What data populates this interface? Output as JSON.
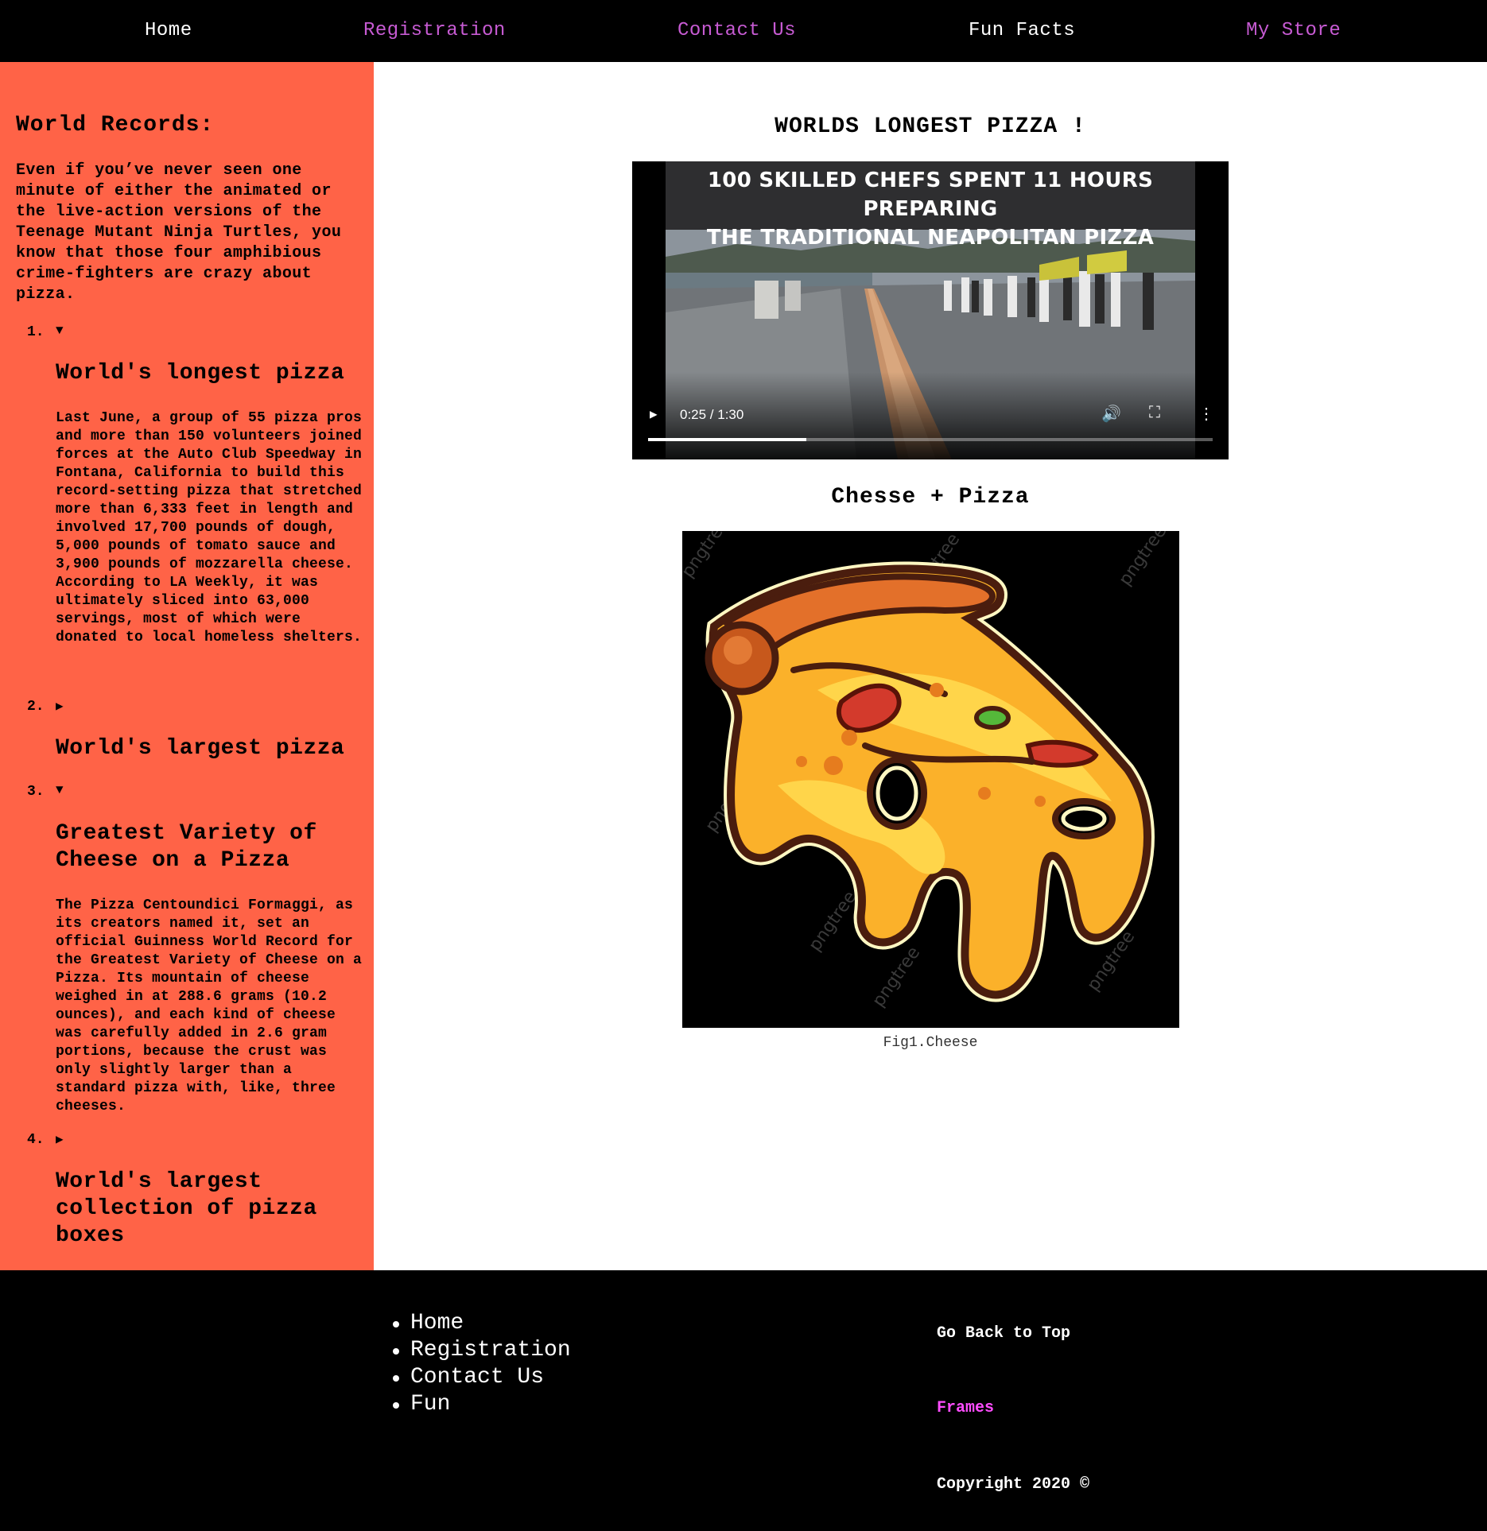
{
  "nav": {
    "items": [
      {
        "label": "Home",
        "color": "#ffffff"
      },
      {
        "label": "Registration",
        "color": "#c75bd3"
      },
      {
        "label": "Contact Us",
        "color": "#c75bd3"
      },
      {
        "label": "Fun Facts",
        "color": "#ffffff"
      },
      {
        "label": "My Store",
        "color": "#c75bd3"
      }
    ]
  },
  "sidebar": {
    "heading": "World Records:",
    "intro": "Even if you’ve never seen one minute of either the animated or the live-action versions of the Teenage Mutant Ninja Turtles, you know that those four amphibious crime-fighters are crazy about pizza.",
    "records": [
      {
        "num": "1.",
        "marker": "▼",
        "title": "World's longest pizza",
        "text": "Last June, a group of 55 pizza pros and more than 150 volunteers joined forces at the Auto Club Speedway in Fontana, California to build this record-setting pizza that stretched more than 6,333 feet in length and involved 17,700 pounds of dough, 5,000 pounds of tomato sauce and 3,900 pounds of mozzarella cheese. According to LA Weekly, it was ultimately sliced into 63,000 servings, most of which were donated to local homeless shelters."
      },
      {
        "num": "2.",
        "marker": "▶",
        "title": "World's largest pizza",
        "text": ""
      },
      {
        "num": "3.",
        "marker": "▼",
        "title": "Greatest Variety of Cheese on a Pizza",
        "text": "The Pizza Centoundici Formaggi, as its creators named it, set an official Guinness World Record for the Greatest Variety of Cheese on a Pizza. Its mountain of cheese weighed in at 288.6 grams (10.2 ounces), and each kind of cheese was carefully added in 2.6 gram portions, because the crust was only slightly larger than a standard pizza with, like, three cheeses."
      },
      {
        "num": "4.",
        "marker": "▶",
        "title": "World's largest collection of pizza boxes",
        "text": ""
      }
    ]
  },
  "main": {
    "title": "WORLDS LONGEST PIZZA !",
    "video": {
      "banner_line1": "100 SKILLED CHEFS SPENT 11 HOURS PREPARING",
      "banner_line2": "THE TRADITIONAL NEAPOLITAN PIZZA",
      "time": "0:25 / 1:30",
      "progress": 0.28
    },
    "subtitle": "Chesse + Pizza",
    "caption": "Fig1.Cheese",
    "watermark": "pngtree"
  },
  "footer": {
    "links": [
      "Home",
      "Registration",
      "Contact Us",
      "Fun"
    ],
    "back_to_top": "Go Back to Top",
    "frames": "Frames",
    "copyright": "Copyright 2020 ©"
  },
  "colors": {
    "sidebar_bg": "#ff6347",
    "nav_bg": "#000000",
    "nav_link_violet": "#c75bd3",
    "footer_frames": "#ff4dff"
  }
}
